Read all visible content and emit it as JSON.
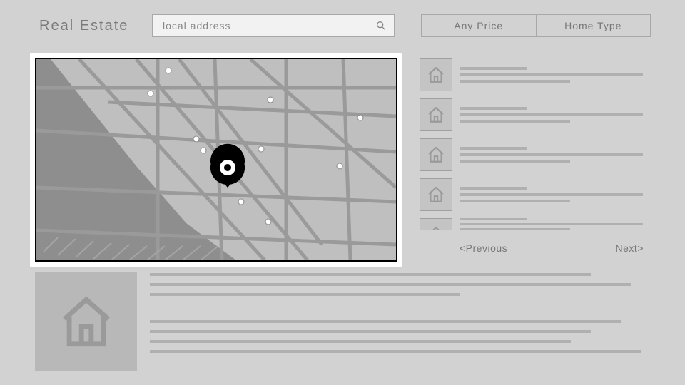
{
  "header": {
    "brand": "Real Estate",
    "search_placeholder": "local address",
    "filters": {
      "price": "Any Price",
      "type": "Home Type"
    }
  },
  "pager": {
    "prev": "<Previous",
    "next": "Next>"
  },
  "listings_count": 5
}
